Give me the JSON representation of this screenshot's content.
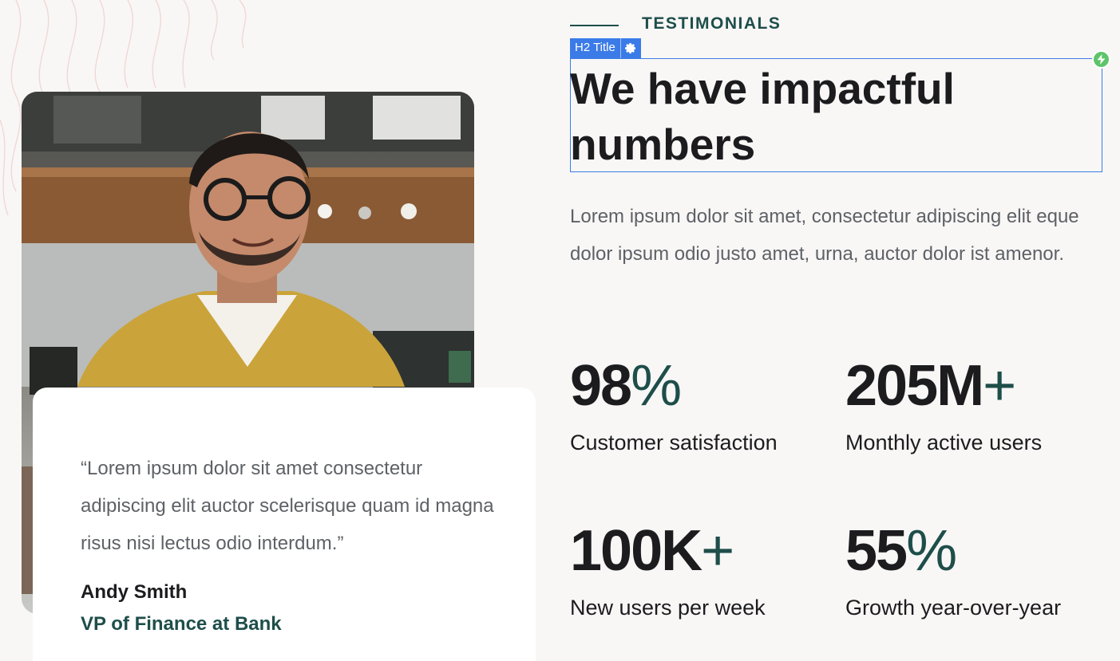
{
  "section": {
    "eyebrow": "TESTIMONIALS",
    "title": "We have impactful numbers",
    "lead": "Lorem ipsum dolor sit amet, consectetur adipiscing elit eque dolor ipsum odio justo amet, urna, auctor dolor ist amenor."
  },
  "editor": {
    "tag_label": "H2 Title",
    "gear_icon": "gear-icon",
    "badge_icon": "lightning-bolt-icon"
  },
  "testimonial": {
    "quote": "“Lorem ipsum dolor sit amet consectetur adipiscing elit auctor scelerisque quam id magna risus nisi lectus odio interdum.”",
    "author": "Andy Smith",
    "role": "VP of Finance at Bank",
    "photo": "portrait-photo"
  },
  "stats": [
    {
      "number": "98",
      "suffix": "%",
      "label": "Customer satisfaction"
    },
    {
      "number": "205M",
      "suffix": "+",
      "label": "Monthly active users"
    },
    {
      "number": "100K",
      "suffix": "+",
      "label": "New users per week"
    },
    {
      "number": "55",
      "suffix": "%",
      "label": "Growth year-over-year"
    }
  ],
  "colors": {
    "background": "#f8f7f6",
    "accent": "#1e4e4a",
    "text": "#1c1c1f",
    "muted": "#5e6166",
    "editor_blue": "#3b7be8",
    "badge_green": "#5ec46a"
  }
}
